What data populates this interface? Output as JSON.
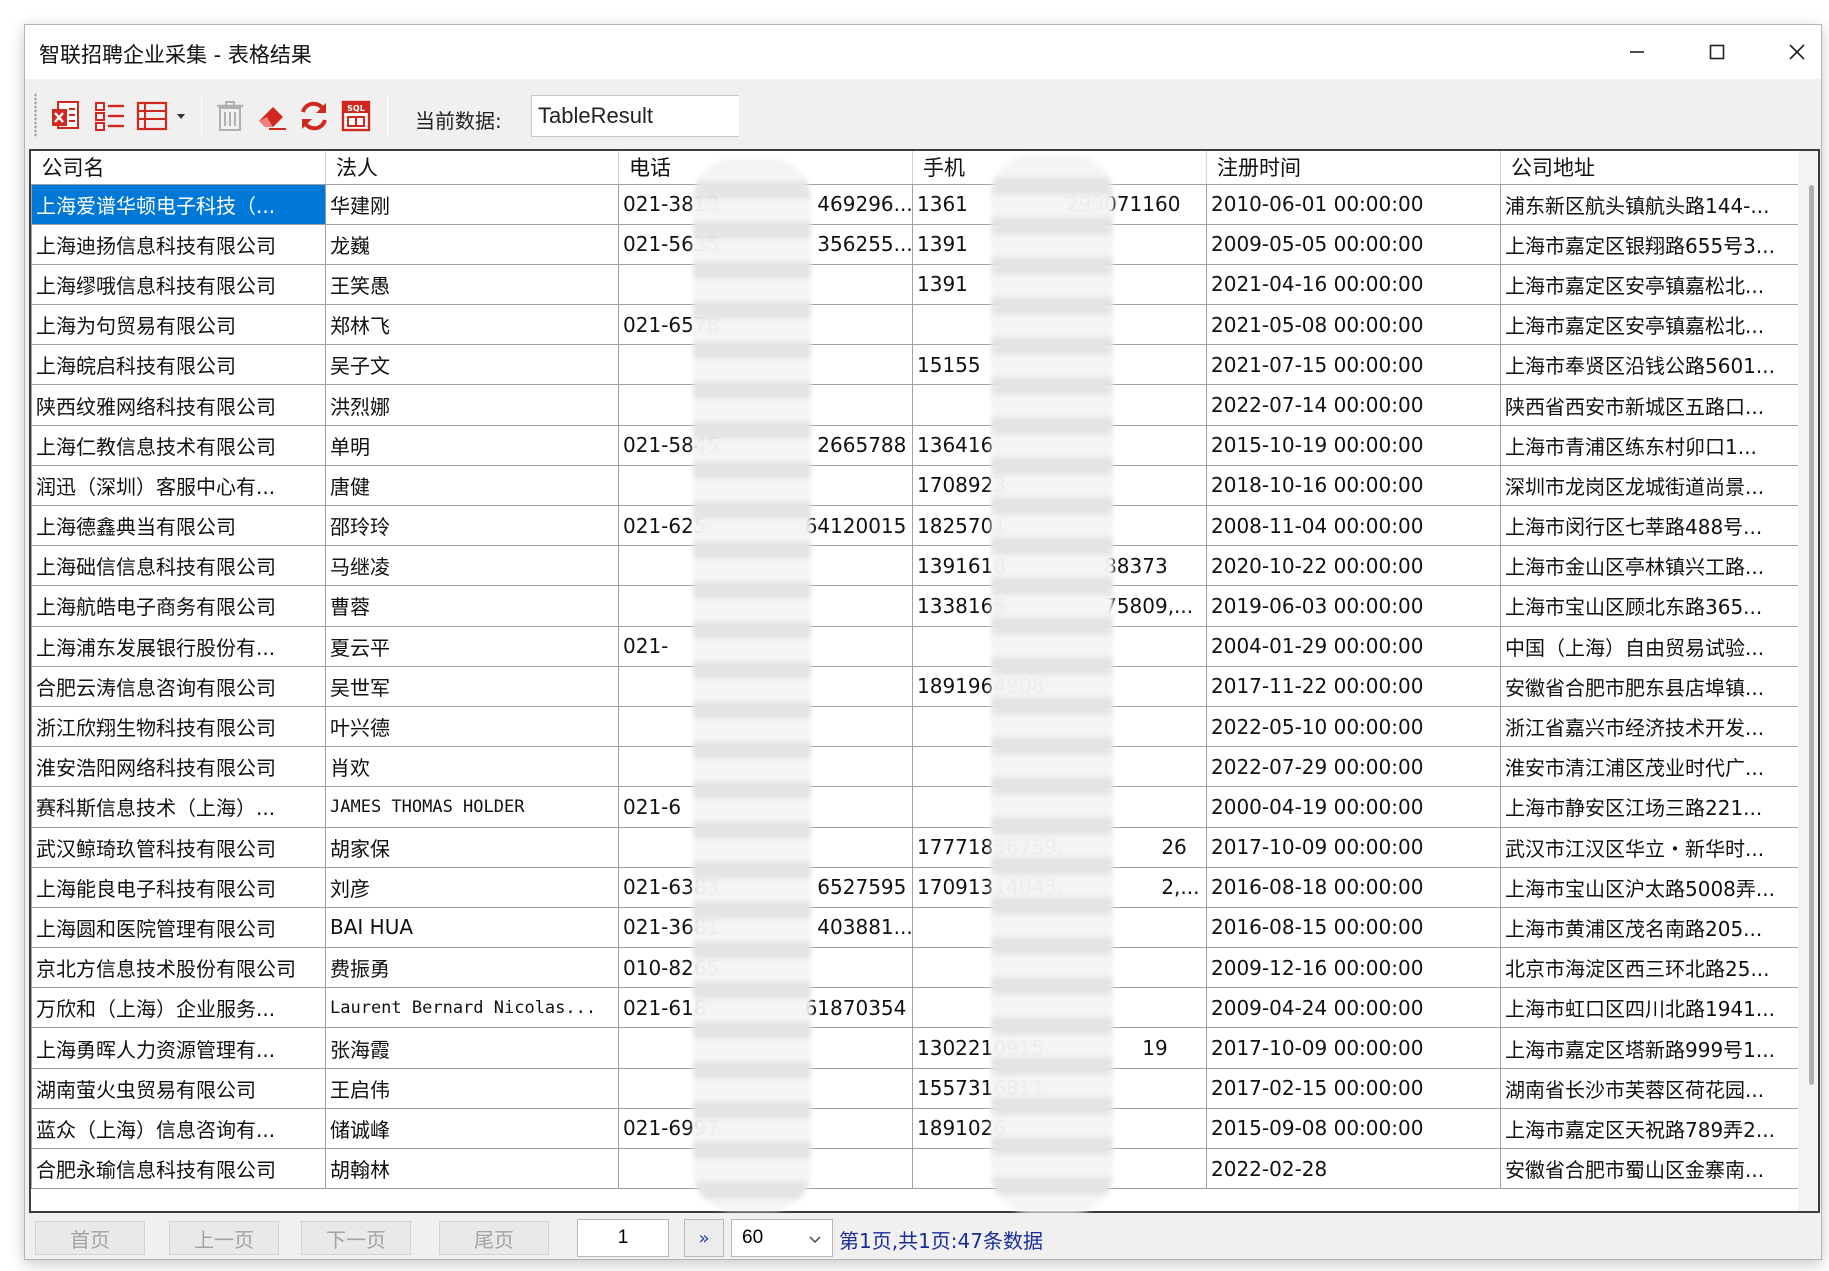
{
  "window": {
    "title": "智联招聘企业采集 - 表格结果"
  },
  "toolbar": {
    "current_data_label": "当前数据:",
    "current_data_value": "TableResult",
    "icons": [
      "export-excel-icon",
      "list-view-icon",
      "table-view-icon",
      "dropdown-arrow-icon",
      "delete-icon",
      "eraser-icon",
      "refresh-icon",
      "sql-export-icon"
    ]
  },
  "table": {
    "columns": [
      "公司名",
      "法人",
      "电话",
      "手机",
      "注册时间",
      "公司地址"
    ],
    "rows": [
      [
        "上海爱谱华顿电子科技（...",
        "华建刚",
        "021-3813",
        "469296...",
        "1361",
        "299071160",
        "2010-06-01 00:00:00",
        "浦东新区航头镇航头路144-..."
      ],
      [
        "上海迪扬信息科技有限公司",
        "龙巍",
        "021-5635",
        "356255...",
        "1391",
        "",
        "2009-05-05 00:00:00",
        "上海市嘉定区银翔路655号3..."
      ],
      [
        "上海缪哦信息科技有限公司",
        "王笑愚",
        "",
        "",
        "1391",
        "",
        "2021-04-16 00:00:00",
        "上海市嘉定区安亭镇嘉松北..."
      ],
      [
        "上海为句贸易有限公司",
        "郑林飞",
        "021-6578",
        "",
        "",
        "",
        "2021-05-08 00:00:00",
        "上海市嘉定区安亭镇嘉松北..."
      ],
      [
        "上海皖启科技有限公司",
        "吴子文",
        "",
        "",
        "15155",
        "",
        "2021-07-15 00:00:00",
        "上海市奉贤区沿钱公路5601..."
      ],
      [
        "陕西纹雅网络科技有限公司",
        "洪烈娜",
        "",
        "",
        "",
        "",
        "2022-07-14 00:00:00",
        "陕西省西安市新城区五路口..."
      ],
      [
        "上海仁教信息技术有限公司",
        "单明",
        "021-5845",
        "2665788",
        "136416",
        "",
        "2015-10-19 00:00:00",
        "上海市青浦区练东村卯口1..."
      ],
      [
        "润迅（深圳）客服中心有...",
        "唐健",
        "",
        "",
        "1708923",
        "",
        "2018-10-16 00:00:00",
        "深圳市龙岗区龙城街道尚景..."
      ],
      [
        "上海德鑫典当有限公司",
        "邵玲玲",
        "021-625",
        "64120015",
        "1825701",
        "",
        "2008-11-04 00:00:00",
        "上海市闵行区七莘路488号..."
      ],
      [
        "上海础信信息科技有限公司",
        "马继凌",
        "",
        "",
        "1391618",
        "88373",
        "2020-10-22 00:00:00",
        "上海市金山区亭林镇兴工路..."
      ],
      [
        "上海航皓电子商务有限公司",
        "曹蓉",
        "",
        "",
        "1338165",
        "75809,...",
        "2019-06-03 00:00:00",
        "上海市宝山区顾北东路365..."
      ],
      [
        "上海浦东发展银行股份有...",
        "夏云平",
        "021-",
        "",
        "",
        "",
        "2004-01-29 00:00:00",
        "中国（上海）自由贸易试验..."
      ],
      [
        "合肥云涛信息咨询有限公司",
        "吴世军",
        "",
        "",
        "1891964908",
        "",
        "2017-11-22 00:00:00",
        "安徽省合肥市肥东县店埠镇..."
      ],
      [
        "浙江欣翔生物科技有限公司",
        "叶兴德",
        "",
        "",
        "",
        "",
        "2022-05-10 00:00:00",
        "浙江省嘉兴市经济技术开发..."
      ],
      [
        "淮安浩阳网络科技有限公司",
        "肖欢",
        "",
        "",
        "",
        "",
        "2022-07-29 00:00:00",
        "淮安市清江浦区茂业时代广..."
      ],
      [
        "赛科斯信息技术（上海）...",
        "JAMES THOMAS HOLDER",
        "021-6",
        "",
        "",
        "",
        "2000-04-19 00:00:00",
        "上海市静安区江场三路221..."
      ],
      [
        "武汉鲸琦玖管科技有限公司",
        "胡家保",
        "",
        "",
        "17771856759,",
        "26",
        "2017-10-09 00:00:00",
        "武汉市江汉区华立・新华时..."
      ],
      [
        "上海能良电子科技有限公司",
        "刘彦",
        "021-6383",
        "6527595",
        "17091314043,",
        "2,...",
        "2016-08-18 00:00:00",
        "上海市宝山区沪太路5008弄..."
      ],
      [
        "上海圆和医院管理有限公司",
        "BAI HUA",
        "021-3681",
        "403881...",
        "",
        "",
        "2016-08-15 00:00:00",
        "上海市黄浦区茂名南路205..."
      ],
      [
        "京北方信息技术股份有限公司",
        "费振勇",
        "010-8265",
        "",
        "",
        "",
        "2009-12-16 00:00:00",
        "北京市海淀区西三环北路25..."
      ],
      [
        "万欣和（上海）企业服务...",
        "Laurent Bernard Nicolas...",
        "021-618",
        "61870354",
        "",
        "",
        "2009-04-24 00:00:00",
        "上海市虹口区四川北路1941..."
      ],
      [
        "上海勇晖人力资源管理有...",
        "张海霞",
        "",
        "",
        "1302210915",
        "19",
        "2017-10-09 00:00:00",
        "上海市嘉定区塔新路999号1..."
      ],
      [
        "湖南萤火虫贸易有限公司",
        "王启伟",
        "",
        "",
        "1557316811",
        "",
        "2017-02-15 00:00:00",
        "湖南省长沙市芙蓉区荷花园..."
      ],
      [
        "蓝众（上海）信息咨询有...",
        "储诚峰",
        "021-6997",
        "",
        "1891026",
        "",
        "2015-09-08 00:00:00",
        "上海市嘉定区天祝路789弄2..."
      ],
      [
        "合肥永瑜信息科技有限公司",
        "胡翰林",
        "",
        "",
        "",
        "",
        "2022-02-28",
        "安徽省合肥市蜀山区金寨南..."
      ]
    ],
    "mono_cells": [
      "JAMES THOMAS HOLDER",
      "Laurent Bernard Nicolas..."
    ]
  },
  "pager": {
    "first": "首页",
    "prev": "上一页",
    "next": "下一页",
    "last": "尾页",
    "page_value": "1",
    "go": "»",
    "page_size": "60",
    "info": "第1页,共1页:47条数据"
  }
}
